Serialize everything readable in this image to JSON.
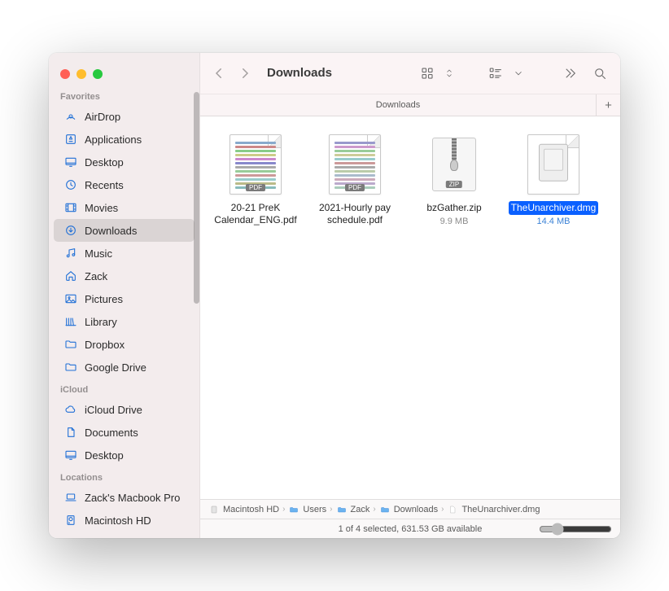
{
  "window_title": "Downloads",
  "tab_label": "Downloads",
  "sidebar": {
    "sections": [
      {
        "header": "Favorites",
        "items": [
          {
            "icon": "airdrop",
            "label": "AirDrop"
          },
          {
            "icon": "applications",
            "label": "Applications"
          },
          {
            "icon": "desktop",
            "label": "Desktop"
          },
          {
            "icon": "recents",
            "label": "Recents"
          },
          {
            "icon": "movies",
            "label": "Movies"
          },
          {
            "icon": "downloads",
            "label": "Downloads",
            "active": true
          },
          {
            "icon": "music",
            "label": "Music"
          },
          {
            "icon": "home",
            "label": "Zack"
          },
          {
            "icon": "pictures",
            "label": "Pictures"
          },
          {
            "icon": "library",
            "label": "Library"
          },
          {
            "icon": "folder",
            "label": "Dropbox"
          },
          {
            "icon": "folder",
            "label": "Google Drive"
          }
        ]
      },
      {
        "header": "iCloud",
        "items": [
          {
            "icon": "cloud",
            "label": "iCloud Drive"
          },
          {
            "icon": "document",
            "label": "Documents"
          },
          {
            "icon": "desktop",
            "label": "Desktop"
          }
        ]
      },
      {
        "header": "Locations",
        "items": [
          {
            "icon": "laptop",
            "label": "Zack's Macbook Pro"
          },
          {
            "icon": "hdd",
            "label": "Macintosh HD"
          }
        ]
      }
    ]
  },
  "files": [
    {
      "name": "20-21 PreK Calendar_ENG.pdf",
      "type": "pdf",
      "meta": "",
      "selected": false
    },
    {
      "name": "2021-Hourly pay schedule.pdf",
      "type": "pdf",
      "meta": "",
      "selected": false
    },
    {
      "name": "bzGather.zip",
      "type": "zip",
      "meta": "9.9 MB",
      "selected": false
    },
    {
      "name": "TheUnarchiver.dmg",
      "type": "dmg",
      "meta": "14.4 MB",
      "selected": true
    }
  ],
  "pathbar": [
    {
      "icon": "hdd",
      "label": "Macintosh HD"
    },
    {
      "icon": "folder",
      "label": "Users"
    },
    {
      "icon": "folder",
      "label": "Zack"
    },
    {
      "icon": "folder",
      "label": "Downloads"
    },
    {
      "icon": "document",
      "label": "TheUnarchiver.dmg"
    }
  ],
  "status_text": "1 of 4 selected, 631.53 GB available",
  "badges": {
    "pdf": "PDF",
    "zip": "ZIP"
  },
  "colors": {
    "accent_blue": "#0a60ff",
    "sidebar_icon": "#1f6fd6"
  }
}
